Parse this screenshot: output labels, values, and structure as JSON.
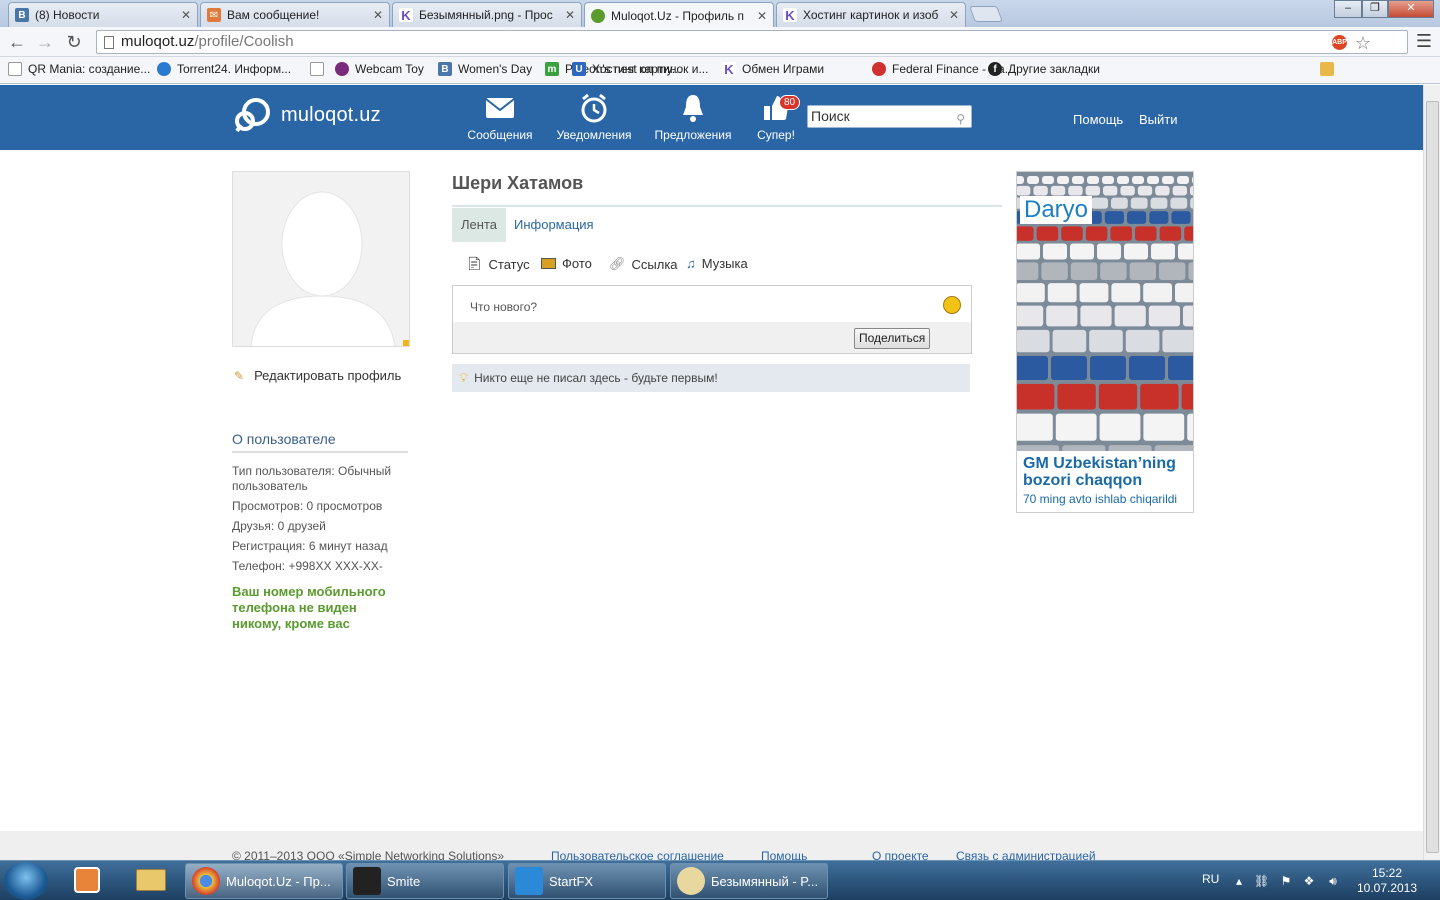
{
  "browser": {
    "tabs": [
      {
        "label": "(8) Новости",
        "favicon": "vk-icon",
        "color": "#4a76a8",
        "letter": "В"
      },
      {
        "label": "Вам сообщение!",
        "favicon": "mail-icon",
        "color": "#e07a3a",
        "letter": "✉"
      },
      {
        "label": "Безымянный.png - Прос",
        "favicon": "k-icon",
        "color": "#6a4fc2",
        "letter": "K"
      },
      {
        "label": "Muloqot.Uz - Профиль п",
        "favicon": "muloqot-icon",
        "color": "#5a9a2e",
        "letter": "O"
      },
      {
        "label": "Хостинг картинок и изоб",
        "favicon": "k-icon",
        "color": "#6a4fc2",
        "letter": "K"
      }
    ],
    "url_host": "muloqot.uz",
    "url_path": "/profile/Coolish",
    "abp_label": "ABP",
    "bookmarks": [
      {
        "label": "QR Mania: создание...",
        "icon": "page-icon",
        "color": "#ffffff"
      },
      {
        "label": "Torrent24. Информ...",
        "icon": "torrent-icon",
        "color": "#2a7ad0"
      },
      {
        "label": "",
        "icon": "page-icon",
        "color": "#ffffff"
      },
      {
        "label": "Webcam Toy",
        "icon": "webcam-icon",
        "color": "#7a2a7a"
      },
      {
        "label": "Women's Day",
        "icon": "vk-icon",
        "color": "#4a76a8"
      },
      {
        "label": "Pigeon's nest on my...",
        "icon": "m-icon",
        "color": "#3aa040"
      },
      {
        "label": "Хостинг картинок и...",
        "icon": "u-icon",
        "color": "#2f66c0"
      },
      {
        "label": "Обмен Играми",
        "icon": "k-icon",
        "color": "#6a4fc2"
      },
      {
        "label": "Federal Finance - На...",
        "icon": "target-icon",
        "color": "#d03030"
      },
      {
        "label": "Другие закладки",
        "icon": "folder-icon",
        "color": "#e8b84a"
      }
    ]
  },
  "site": {
    "logo_text": "muloqot.uz",
    "nav": [
      {
        "label": "Сообщения",
        "icon": "envelope-icon"
      },
      {
        "label": "Уведомления",
        "icon": "alarm-clock-icon"
      },
      {
        "label": "Предложения",
        "icon": "bell-icon"
      },
      {
        "label": "Супер!",
        "icon": "thumbs-up-icon",
        "badge": "80"
      }
    ],
    "search_placeholder": "Поиск",
    "help_label": "Помощь",
    "logout_label": "Выйти",
    "accent": "#2a66a6"
  },
  "profile": {
    "name": "Шери Хатамов",
    "edit_label": "Редактировать профиль",
    "about_title": "О пользователе",
    "about": [
      "Тип пользователя: Обычный пользователь",
      "Просмотров: 0 просмотров",
      "Друзья: 0 друзей",
      "Регистрация: 6 минут назад",
      "Телефон: +998XX XXX-XX-"
    ],
    "phone_note": "Ваш номер мобильного телефона не виден никому, кроме вас",
    "tabs": [
      "Лента",
      "Информация"
    ],
    "post_types": [
      {
        "label": "Статус",
        "icon": "document-icon"
      },
      {
        "label": "Фото",
        "icon": "photo-icon"
      },
      {
        "label": "Ссылка",
        "icon": "paperclip-icon"
      },
      {
        "label": "Музыка",
        "icon": "music-note-icon"
      }
    ],
    "composer_placeholder": "Что нового?",
    "share_label": "Поделиться",
    "empty_note": "Никто еще не писал здесь - будьте первым!"
  },
  "ad": {
    "brand": "Daryo",
    "headline": "GM Uzbekistan’ning bozori chaqqon",
    "subline": "70 ming avto ishlab chiqarildi"
  },
  "footer": {
    "copyright": "© 2011–2013 ООО «Simple Networking Solutions»",
    "links": [
      "Пользовательское соглашение",
      "Помощь",
      "О проекте",
      "Связь с администрацией"
    ]
  },
  "taskbar": {
    "tasks": [
      {
        "label": "Muloqot.Uz - Пр...",
        "icon": "chrome-icon",
        "color": "#e8c040"
      },
      {
        "label": "Smite",
        "icon": "smite-icon",
        "color": "#222222"
      },
      {
        "label": "StartFX",
        "icon": "startfx-icon",
        "color": "#2a8ad8"
      },
      {
        "label": "Безымянный - P...",
        "icon": "paint-icon",
        "color": "#e8d8a0"
      }
    ],
    "language": "RU",
    "time": "15:22",
    "date": "10.07.2013"
  }
}
